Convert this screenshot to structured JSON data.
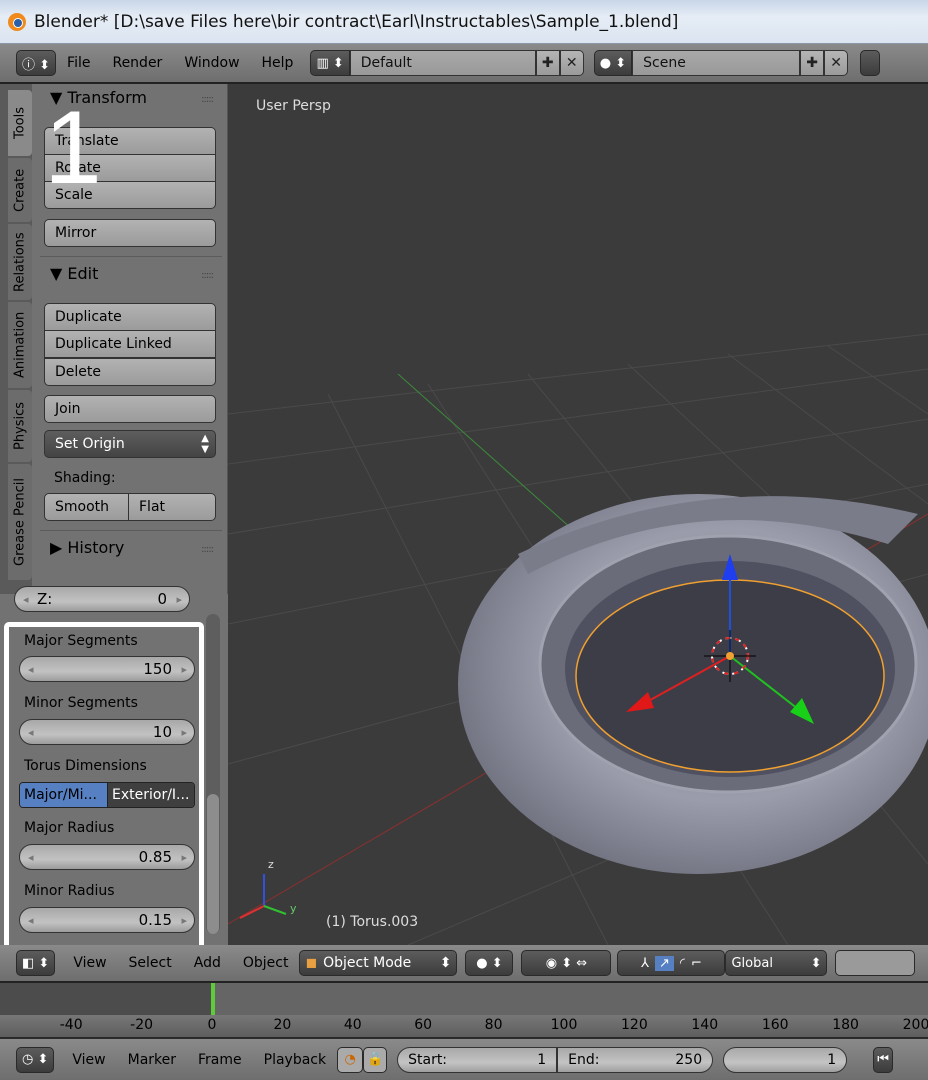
{
  "window": {
    "title": "Blender* [D:\\save Files here\\bir contract\\Earl\\Instructables\\Sample_1.blend]"
  },
  "topbar": {
    "menus": [
      "File",
      "Render",
      "Window",
      "Help"
    ],
    "layout": "Default",
    "scene": "Scene"
  },
  "tabs": [
    "Tools",
    "Create",
    "Relations",
    "Animation",
    "Physics",
    "Grease Pencil"
  ],
  "tools": {
    "transform_header": "Transform",
    "transform_buttons": [
      "Translate",
      "Rotate",
      "Scale"
    ],
    "mirror": "Mirror",
    "edit_header": "Edit",
    "edit_buttons": [
      "Duplicate",
      "Duplicate Linked",
      "Delete"
    ],
    "join": "Join",
    "set_origin": "Set Origin",
    "shading_label": "Shading:",
    "smooth": "Smooth",
    "flat": "Flat",
    "history_header": "History"
  },
  "annotation": {
    "step_number": "1"
  },
  "operator": {
    "partial_row_label": "Z:",
    "partial_row_value": "0",
    "major_segments_label": "Major Segments",
    "major_segments": "150",
    "minor_segments_label": "Minor Segments",
    "minor_segments": "10",
    "dimensions_label": "Torus Dimensions",
    "dim_options": [
      "Major/Mi...",
      "Exterior/I..."
    ],
    "dim_selected": "Major/Mi...",
    "major_radius_label": "Major Radius",
    "major_radius": "0.85",
    "minor_radius_label": "Minor Radius",
    "minor_radius": "0.15"
  },
  "viewport": {
    "view_name": "User Persp",
    "object_name": "(1) Torus.003",
    "axis_labels": [
      "z",
      "x",
      "y"
    ]
  },
  "view3d_header": {
    "menus": [
      "View",
      "Select",
      "Add",
      "Object"
    ],
    "mode": "Object Mode",
    "orientation": "Global"
  },
  "timeline": {
    "ruler_ticks": [
      "-40",
      "-20",
      "0",
      "20",
      "40",
      "60",
      "80",
      "100",
      "120",
      "140",
      "160",
      "180",
      "200"
    ],
    "current_frame_marker": 0
  },
  "timeline_header": {
    "menus": [
      "View",
      "Marker",
      "Frame",
      "Playback"
    ],
    "start_label": "Start:",
    "start": "1",
    "end_label": "End:",
    "end": "250",
    "current": "1"
  },
  "colors": {
    "accent_blue": "#5680c2",
    "frame_marker": "#5ecb3a",
    "selection_orange": "#f0a030"
  }
}
